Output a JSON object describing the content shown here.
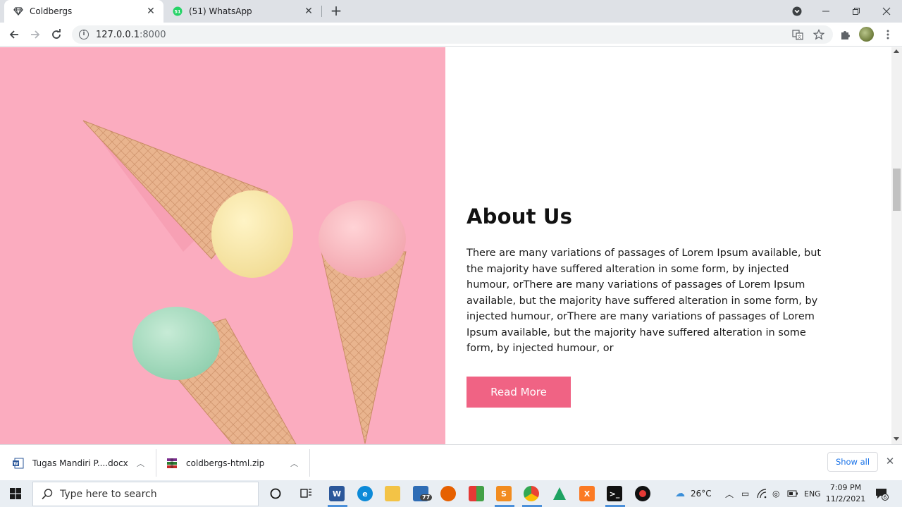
{
  "browser": {
    "tabs": [
      {
        "title": "Coldbergs",
        "active": true,
        "icon": "diamond-icon"
      },
      {
        "title": "(51) WhatsApp",
        "active": false,
        "icon": "whatsapp-icon",
        "badge": "51"
      }
    ],
    "url_host": "127.0.0.1",
    "url_port": ":8000"
  },
  "page": {
    "about_title": "About Us",
    "about_text": "There are many variations of passages of Lorem Ipsum available, but the majority have suffered alteration in some form, by injected humour, orThere are many variations of passages of Lorem Ipsum available, but the majority have suffered alteration in some form, by injected humour, orThere are many variations of passages of Lorem Ipsum available, but the majority have suffered alteration in some form, by injected humour, or",
    "read_more_label": "Read More",
    "image_bg_color": "#fbacbf",
    "button_color": "#f06384"
  },
  "downloads": {
    "items": [
      {
        "name": "Tugas  Mandiri P....docx",
        "icon": "word-doc-icon"
      },
      {
        "name": "coldbergs-html.zip",
        "icon": "zip-archive-icon"
      }
    ],
    "show_all_label": "Show all"
  },
  "taskbar": {
    "search_placeholder": "Type here to search",
    "mail_badge": "77",
    "weather_temp": "26°C",
    "language": "ENG",
    "time": "7:09 PM",
    "date": "11/2/2021",
    "notification_count": "6"
  }
}
